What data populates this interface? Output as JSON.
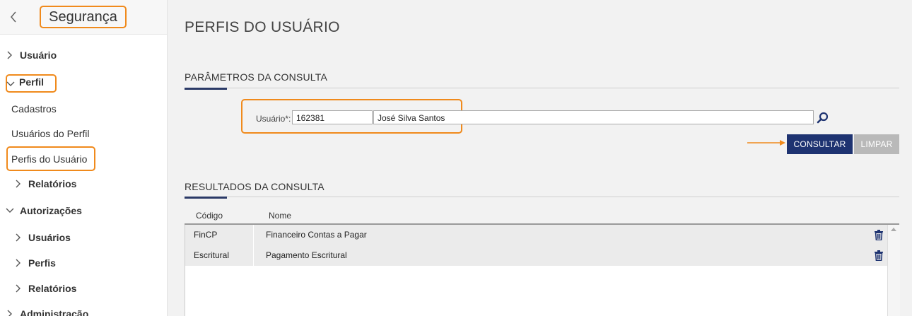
{
  "sidebar": {
    "title": "Segurança",
    "items": {
      "usuario": "Usuário",
      "perfil": "Perfil",
      "cadastros": "Cadastros",
      "usuarios_do_perfil": "Usuários do Perfil",
      "perfis_do_usuario": "Perfis do Usuário",
      "relatorios_perfil": "Relatórios",
      "autorizacoes": "Autorizações",
      "usuarios_aut": "Usuários",
      "perfis_aut": "Perfis",
      "relatorios_aut": "Relatórios",
      "administracao": "Administração"
    }
  },
  "main": {
    "page_title": "PERFIS DO USUÁRIO",
    "params_title": "PARÂMETROS DA CONSULTA",
    "user_label": "Usuário*:",
    "user_code": "162381",
    "user_name": "José Silva Santos",
    "consultar": "CONSULTAR",
    "limpar": "LIMPAR",
    "results_title": "RESULTADOS DA CONSULTA",
    "table": {
      "headers": {
        "codigo": "Código",
        "nome": "Nome"
      },
      "rows": [
        {
          "codigo": "FinCP",
          "nome": "Financeiro Contas a Pagar"
        },
        {
          "codigo": "Escritural",
          "nome": "Pagamento Escritural"
        }
      ]
    }
  },
  "colors": {
    "primary": "#1e3371",
    "highlight": "#f08a1c",
    "accent_line": "#2b3a67"
  }
}
